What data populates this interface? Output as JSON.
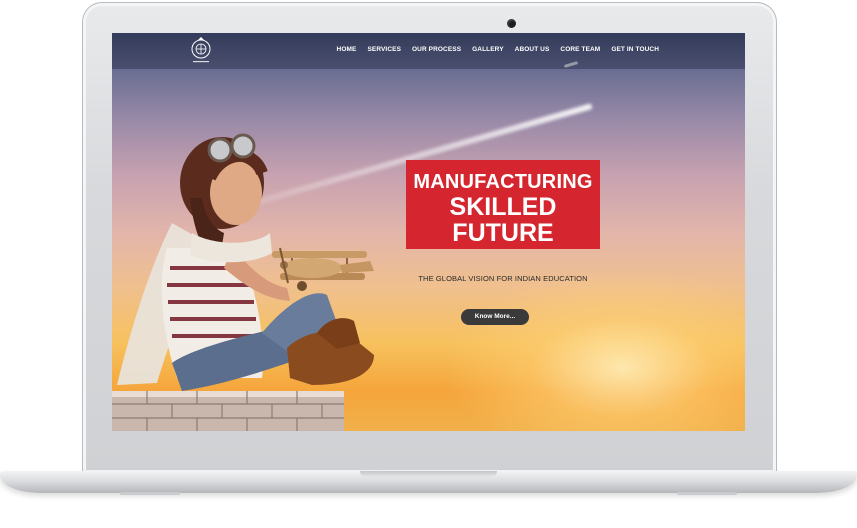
{
  "nav": {
    "items": [
      "HOME",
      "SERVICES",
      "OUR PROCESS",
      "GALLERY",
      "ABOUT US",
      "CORE TEAM",
      "GET IN TOUCH"
    ]
  },
  "hero": {
    "headline_line1": "MANUFACTURING",
    "headline_line2": "SKILLED",
    "headline_line3": "FUTURE",
    "tagline": "THE GLOBAL VISION FOR INDIAN EDUCATION",
    "cta_label": "Know More..."
  },
  "colors": {
    "accent": "#d5262f",
    "button": "#3a3a3a",
    "nav_text": "#ffffff"
  }
}
